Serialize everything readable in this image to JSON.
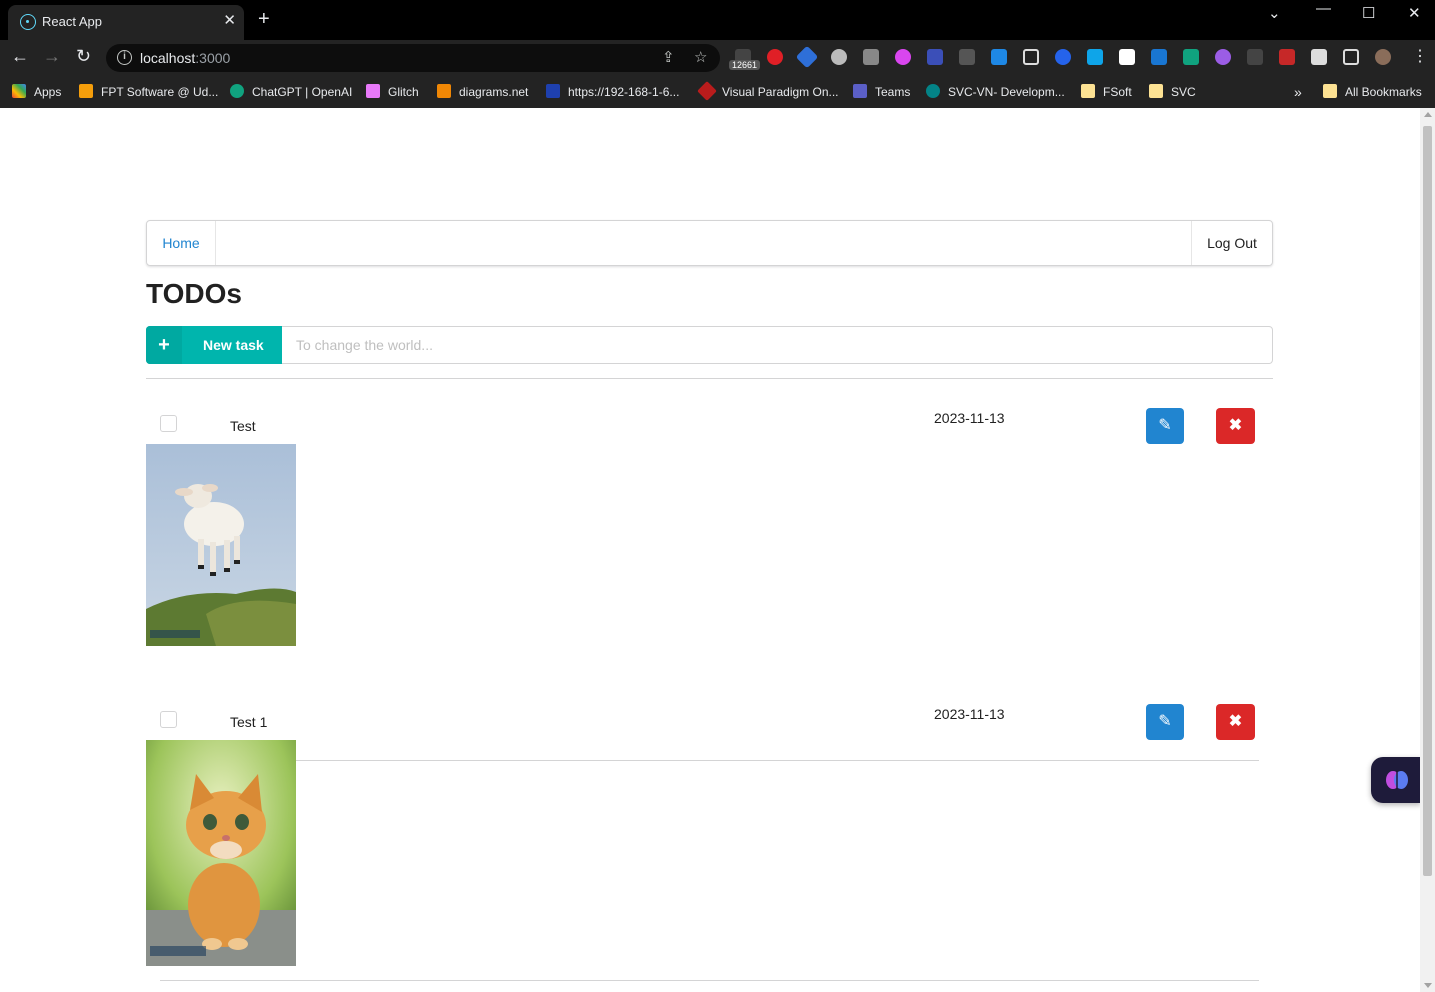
{
  "browser": {
    "tab_title": "React App",
    "url_host": "localhost",
    "url_port": ":3000",
    "extension_badge": "12661",
    "bookmarks": [
      {
        "label": "Apps"
      },
      {
        "label": "FPT Software @ Ud..."
      },
      {
        "label": "ChatGPT | OpenAI"
      },
      {
        "label": "Glitch"
      },
      {
        "label": "diagrams.net"
      },
      {
        "label": "https://192-168-1-6..."
      },
      {
        "label": "Visual Paradigm On..."
      },
      {
        "label": "Teams"
      },
      {
        "label": "SVC-VN- Developm..."
      },
      {
        "label": "FSoft"
      },
      {
        "label": "SVC"
      },
      {
        "label": "All Bookmarks"
      }
    ],
    "bookmarks_overflow": "»"
  },
  "nav": {
    "home_label": "Home",
    "logout_label": "Log Out"
  },
  "page_title": "TODOs",
  "new_task": {
    "button_label": "New task",
    "placeholder": "To change the world...",
    "value": ""
  },
  "todos": [
    {
      "name": "Test",
      "due_date": "2023-11-13",
      "done": false,
      "image": "lamb-photo"
    },
    {
      "name": "Test 1",
      "due_date": "2023-11-13",
      "done": false,
      "image": "kitten-photo"
    }
  ],
  "colors": {
    "teal": "#00b5ad",
    "blue": "#2185d0",
    "red": "#db2828",
    "link": "#2185d0"
  }
}
